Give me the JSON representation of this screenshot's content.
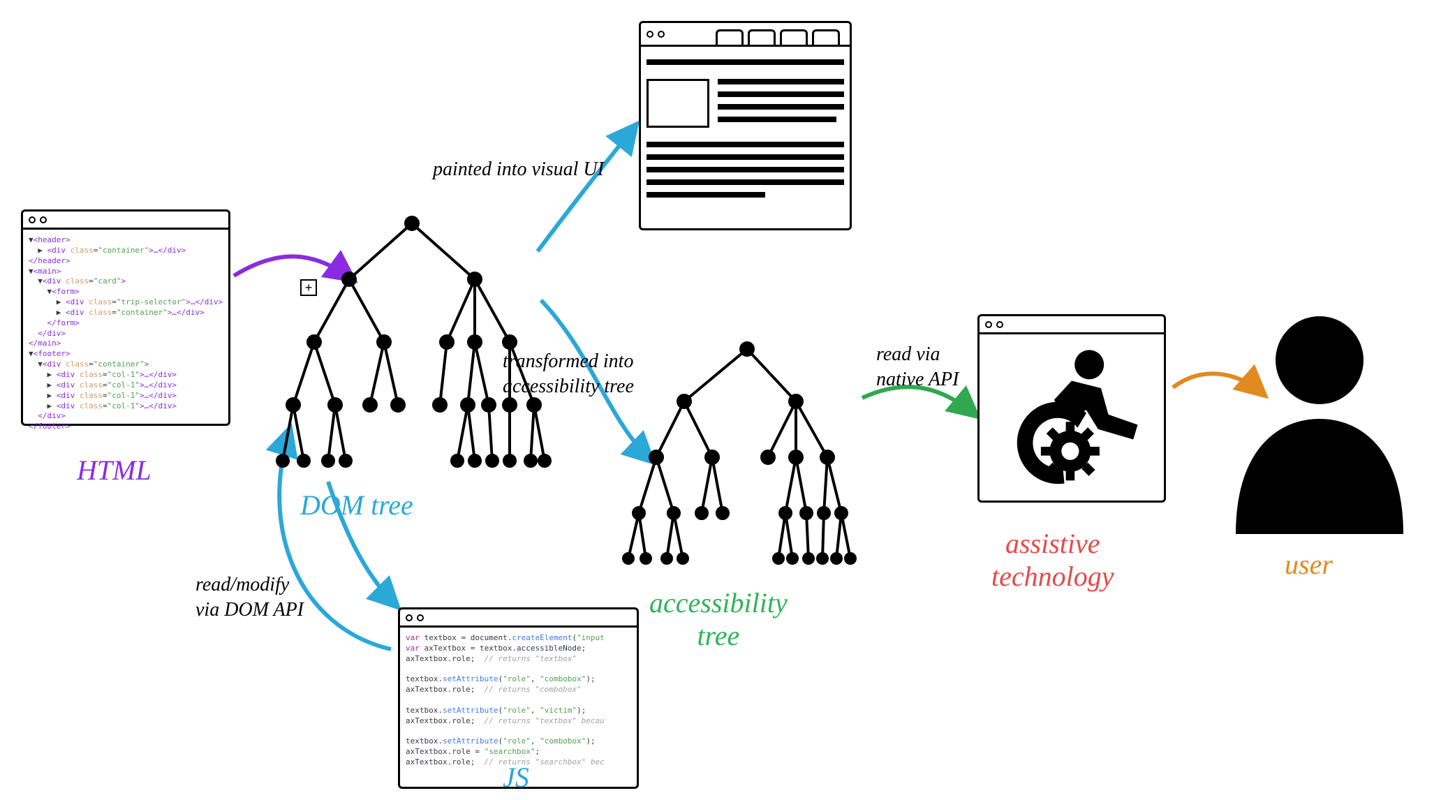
{
  "labels": {
    "html": "HTML",
    "dom_tree": "DOM tree",
    "js": "JS",
    "accessibility_tree_line1": "accessibility",
    "accessibility_tree_line2": "tree",
    "assistive_line1": "assistive",
    "assistive_line2": "technology",
    "user": "user"
  },
  "annotations": {
    "painted": "painted into visual UI",
    "transformed_line1": "transformed into",
    "transformed_line2": "accessibility tree",
    "read_modify_line1": "read/modify",
    "read_modify_line2": "via DOM API",
    "read_native_line1": "read via",
    "read_native_line2": "native API"
  },
  "colors": {
    "html": "#8a2be2",
    "dom": "#2aa8d8",
    "js": "#2aa8d8",
    "a11y": "#2fb455",
    "at": "#e44a4a",
    "user": "#e08a1f",
    "arrow_native": "#2fa84f"
  },
  "html_code": [
    {
      "indent": 0,
      "parts": [
        {
          "t": "▼",
          "c": "plain"
        },
        {
          "t": "<header>",
          "c": "tag"
        }
      ]
    },
    {
      "indent": 1,
      "parts": [
        {
          "t": "▶ ",
          "c": "plain"
        },
        {
          "t": "<div ",
          "c": "tag"
        },
        {
          "t": "class",
          "c": "attr"
        },
        {
          "t": "=",
          "c": "plain"
        },
        {
          "t": "\"container\"",
          "c": "str"
        },
        {
          "t": ">…</div>",
          "c": "tag"
        }
      ]
    },
    {
      "indent": 0,
      "parts": [
        {
          "t": "</header>",
          "c": "tag"
        }
      ]
    },
    {
      "indent": 0,
      "parts": [
        {
          "t": "▼",
          "c": "plain"
        },
        {
          "t": "<main>",
          "c": "tag"
        }
      ]
    },
    {
      "indent": 1,
      "parts": [
        {
          "t": "▼",
          "c": "plain"
        },
        {
          "t": "<div ",
          "c": "tag"
        },
        {
          "t": "class",
          "c": "attr"
        },
        {
          "t": "=",
          "c": "plain"
        },
        {
          "t": "\"card\"",
          "c": "str"
        },
        {
          "t": ">",
          "c": "tag"
        }
      ]
    },
    {
      "indent": 2,
      "parts": [
        {
          "t": "▼",
          "c": "plain"
        },
        {
          "t": "<form>",
          "c": "tag"
        }
      ]
    },
    {
      "indent": 3,
      "parts": [
        {
          "t": "▶ ",
          "c": "plain"
        },
        {
          "t": "<div ",
          "c": "tag"
        },
        {
          "t": "class",
          "c": "attr"
        },
        {
          "t": "=",
          "c": "plain"
        },
        {
          "t": "\"trip-selector\"",
          "c": "str"
        },
        {
          "t": ">…</div>",
          "c": "tag"
        }
      ]
    },
    {
      "indent": 3,
      "parts": [
        {
          "t": "▶ ",
          "c": "plain"
        },
        {
          "t": "<div ",
          "c": "tag"
        },
        {
          "t": "class",
          "c": "attr"
        },
        {
          "t": "=",
          "c": "plain"
        },
        {
          "t": "\"container\"",
          "c": "str"
        },
        {
          "t": ">…</div>",
          "c": "tag"
        }
      ]
    },
    {
      "indent": 2,
      "parts": [
        {
          "t": "</form>",
          "c": "tag"
        }
      ]
    },
    {
      "indent": 1,
      "parts": [
        {
          "t": "</div>",
          "c": "tag"
        }
      ]
    },
    {
      "indent": 0,
      "parts": [
        {
          "t": "</main>",
          "c": "tag"
        }
      ]
    },
    {
      "indent": 0,
      "parts": [
        {
          "t": "▼",
          "c": "plain"
        },
        {
          "t": "<footer>",
          "c": "tag"
        }
      ]
    },
    {
      "indent": 1,
      "parts": [
        {
          "t": "▼",
          "c": "plain"
        },
        {
          "t": "<div ",
          "c": "tag"
        },
        {
          "t": "class",
          "c": "attr"
        },
        {
          "t": "=",
          "c": "plain"
        },
        {
          "t": "\"container\"",
          "c": "str"
        },
        {
          "t": ">",
          "c": "tag"
        }
      ]
    },
    {
      "indent": 2,
      "parts": [
        {
          "t": "▶ ",
          "c": "plain"
        },
        {
          "t": "<div ",
          "c": "tag"
        },
        {
          "t": "class",
          "c": "attr"
        },
        {
          "t": "=",
          "c": "plain"
        },
        {
          "t": "\"col-1\"",
          "c": "str"
        },
        {
          "t": ">…</div>",
          "c": "tag"
        }
      ]
    },
    {
      "indent": 2,
      "parts": [
        {
          "t": "▶ ",
          "c": "plain"
        },
        {
          "t": "<div ",
          "c": "tag"
        },
        {
          "t": "class",
          "c": "attr"
        },
        {
          "t": "=",
          "c": "plain"
        },
        {
          "t": "\"col-1\"",
          "c": "str"
        },
        {
          "t": ">…</div>",
          "c": "tag"
        }
      ]
    },
    {
      "indent": 2,
      "parts": [
        {
          "t": "▶ ",
          "c": "plain"
        },
        {
          "t": "<div ",
          "c": "tag"
        },
        {
          "t": "class",
          "c": "attr"
        },
        {
          "t": "=",
          "c": "plain"
        },
        {
          "t": "\"col-1\"",
          "c": "str"
        },
        {
          "t": ">…</div>",
          "c": "tag"
        }
      ]
    },
    {
      "indent": 2,
      "parts": [
        {
          "t": "▶ ",
          "c": "plain"
        },
        {
          "t": "<div ",
          "c": "tag"
        },
        {
          "t": "class",
          "c": "attr"
        },
        {
          "t": "=",
          "c": "plain"
        },
        {
          "t": "\"col-1\"",
          "c": "str"
        },
        {
          "t": ">…</div>",
          "c": "tag"
        }
      ]
    },
    {
      "indent": 1,
      "parts": [
        {
          "t": "</div>",
          "c": "tag"
        }
      ]
    },
    {
      "indent": 0,
      "parts": [
        {
          "t": "</footer>",
          "c": "tag"
        }
      ]
    }
  ],
  "js_code": [
    {
      "parts": [
        {
          "t": "var ",
          "c": "kw"
        },
        {
          "t": "textbox = document.",
          "c": "plain"
        },
        {
          "t": "createElement",
          "c": "fn"
        },
        {
          "t": "(",
          "c": "plain"
        },
        {
          "t": "\"input",
          "c": "str"
        }
      ]
    },
    {
      "parts": [
        {
          "t": "var ",
          "c": "kw"
        },
        {
          "t": "axTextbox = textbox.accessibleNode;",
          "c": "plain"
        }
      ]
    },
    {
      "parts": [
        {
          "t": "axTextbox.role;  ",
          "c": "plain"
        },
        {
          "t": "// returns \"textbox\"",
          "c": "cm"
        }
      ]
    },
    {
      "parts": [
        {
          "t": "",
          "c": "plain"
        }
      ]
    },
    {
      "parts": [
        {
          "t": "textbox.",
          "c": "plain"
        },
        {
          "t": "setAttribute",
          "c": "fn"
        },
        {
          "t": "(",
          "c": "plain"
        },
        {
          "t": "\"role\"",
          "c": "str"
        },
        {
          "t": ", ",
          "c": "plain"
        },
        {
          "t": "\"combobox\"",
          "c": "str"
        },
        {
          "t": ");",
          "c": "plain"
        }
      ]
    },
    {
      "parts": [
        {
          "t": "axTextbox.role;  ",
          "c": "plain"
        },
        {
          "t": "// returns \"combobox\"",
          "c": "cm"
        }
      ]
    },
    {
      "parts": [
        {
          "t": "",
          "c": "plain"
        }
      ]
    },
    {
      "parts": [
        {
          "t": "textbox.",
          "c": "plain"
        },
        {
          "t": "setAttribute",
          "c": "fn"
        },
        {
          "t": "(",
          "c": "plain"
        },
        {
          "t": "\"role\"",
          "c": "str"
        },
        {
          "t": ", ",
          "c": "plain"
        },
        {
          "t": "\"victim\"",
          "c": "str"
        },
        {
          "t": ");",
          "c": "plain"
        }
      ]
    },
    {
      "parts": [
        {
          "t": "axTextbox.role;  ",
          "c": "plain"
        },
        {
          "t": "// returns \"textbox\" becau",
          "c": "cm"
        }
      ]
    },
    {
      "parts": [
        {
          "t": "",
          "c": "plain"
        }
      ]
    },
    {
      "parts": [
        {
          "t": "textbox.",
          "c": "plain"
        },
        {
          "t": "setAttribute",
          "c": "fn"
        },
        {
          "t": "(",
          "c": "plain"
        },
        {
          "t": "\"role\"",
          "c": "str"
        },
        {
          "t": ", ",
          "c": "plain"
        },
        {
          "t": "\"combobox\"",
          "c": "str"
        },
        {
          "t": ");",
          "c": "plain"
        }
      ]
    },
    {
      "parts": [
        {
          "t": "axTextbox.role = ",
          "c": "plain"
        },
        {
          "t": "\"searchbox\"",
          "c": "str"
        },
        {
          "t": ";",
          "c": "plain"
        }
      ]
    },
    {
      "parts": [
        {
          "t": "axTextbox.role;  ",
          "c": "plain"
        },
        {
          "t": "// returns \"searchbox\" bec",
          "c": "cm"
        }
      ]
    }
  ]
}
